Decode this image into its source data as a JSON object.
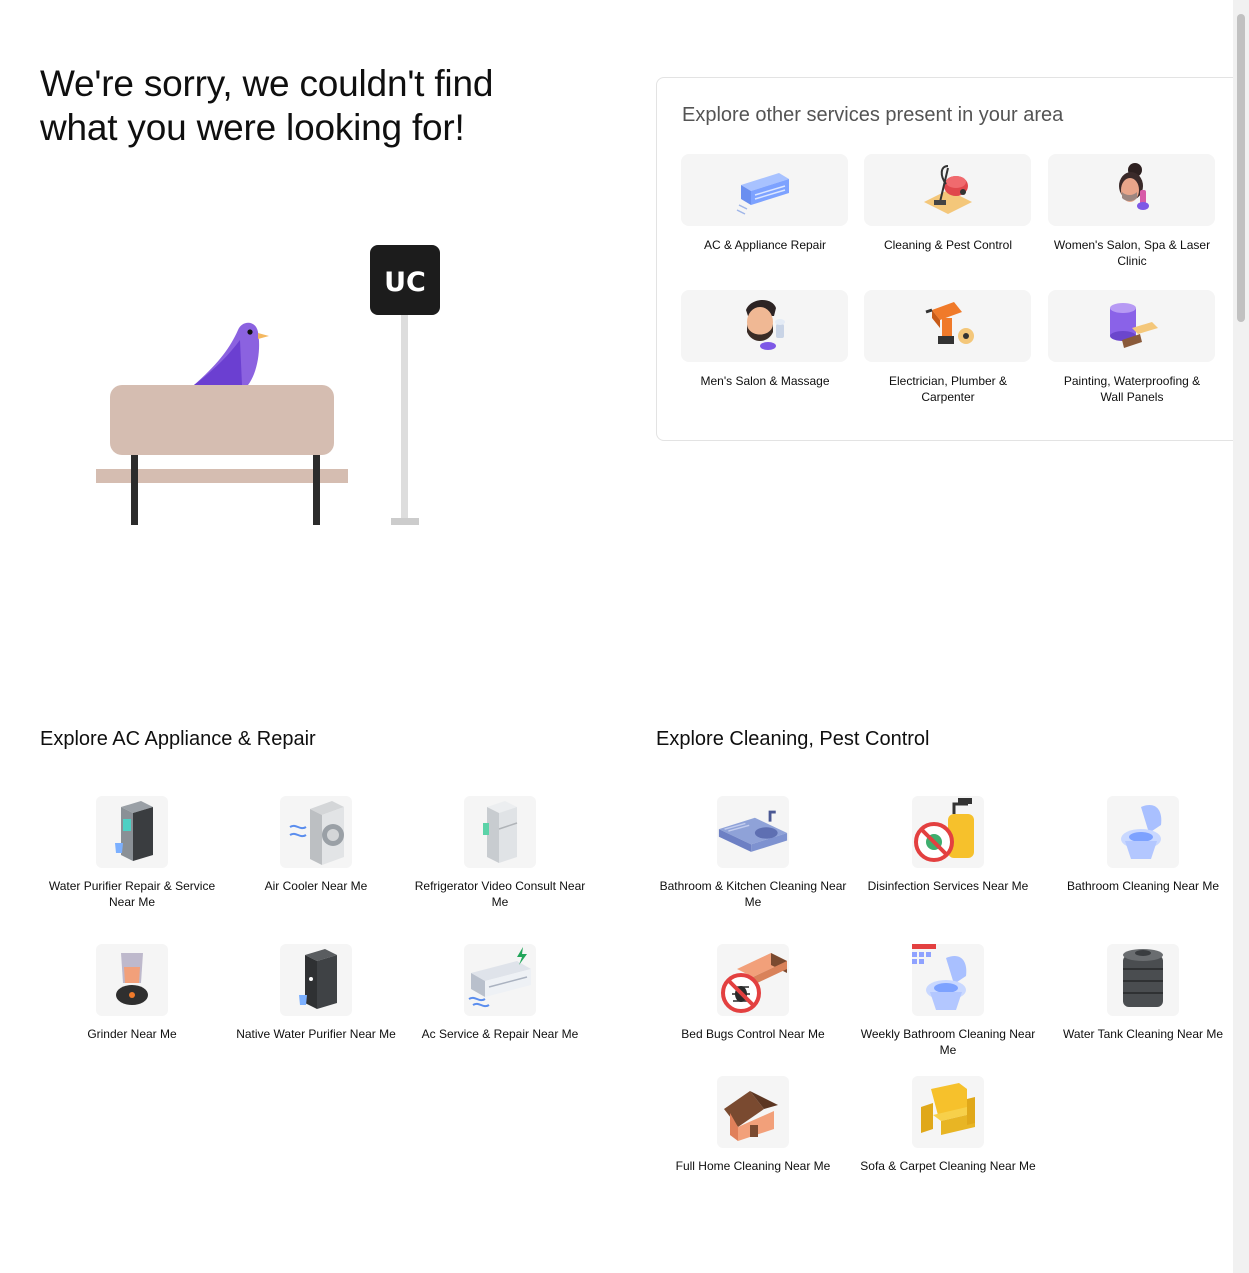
{
  "headline": "We're sorry, we couldn't find what you were looking for!",
  "illustration": {
    "sign_text": "UC"
  },
  "explore": {
    "title": "Explore other services present in your area",
    "services": [
      {
        "label": "AC & Appliance Repair",
        "icon": "ac-unit-icon"
      },
      {
        "label": "Cleaning & Pest Control",
        "icon": "vacuum-cleaner-icon"
      },
      {
        "label": "Women's Salon, Spa & Laser Clinic",
        "icon": "woman-facial-icon"
      },
      {
        "label": "Men's Salon & Massage",
        "icon": "bearded-man-icon"
      },
      {
        "label": "Electrician, Plumber & Carpenter",
        "icon": "power-drill-icon"
      },
      {
        "label": "Painting, Waterproofing & Wall Panels",
        "icon": "paint-bucket-icon"
      }
    ]
  },
  "sections": {
    "ac": {
      "title": "Explore AC Appliance & Repair",
      "items": [
        {
          "label": "Water Purifier Repair & Service Near Me",
          "icon": "water-purifier-icon"
        },
        {
          "label": "Air Cooler Near Me",
          "icon": "air-cooler-icon"
        },
        {
          "label": "Refrigerator Video Consult Near Me",
          "icon": "refrigerator-icon"
        },
        {
          "label": "Grinder Near Me",
          "icon": "grinder-icon"
        },
        {
          "label": "Native Water Purifier Near Me",
          "icon": "native-water-purifier-icon"
        },
        {
          "label": "Ac Service & Repair Near Me",
          "icon": "ac-service-icon"
        }
      ]
    },
    "cleaning": {
      "title": "Explore Cleaning, Pest Control",
      "items": [
        {
          "label": "Bathroom & Kitchen Cleaning Near Me",
          "icon": "kitchen-sink-icon"
        },
        {
          "label": "Disinfection Services Near Me",
          "icon": "disinfection-sprayer-icon"
        },
        {
          "label": "Bathroom Cleaning Near Me",
          "icon": "toilet-icon"
        },
        {
          "label": "Bed Bugs Control Near Me",
          "icon": "bed-bug-icon"
        },
        {
          "label": "Weekly Bathroom Cleaning Near Me",
          "icon": "weekly-toilet-icon"
        },
        {
          "label": "Water Tank Cleaning Near Me",
          "icon": "water-tank-icon"
        },
        {
          "label": "Full Home Cleaning Near Me",
          "icon": "house-icon"
        },
        {
          "label": "Sofa & Carpet Cleaning Near Me",
          "icon": "armchair-icon"
        }
      ]
    }
  }
}
